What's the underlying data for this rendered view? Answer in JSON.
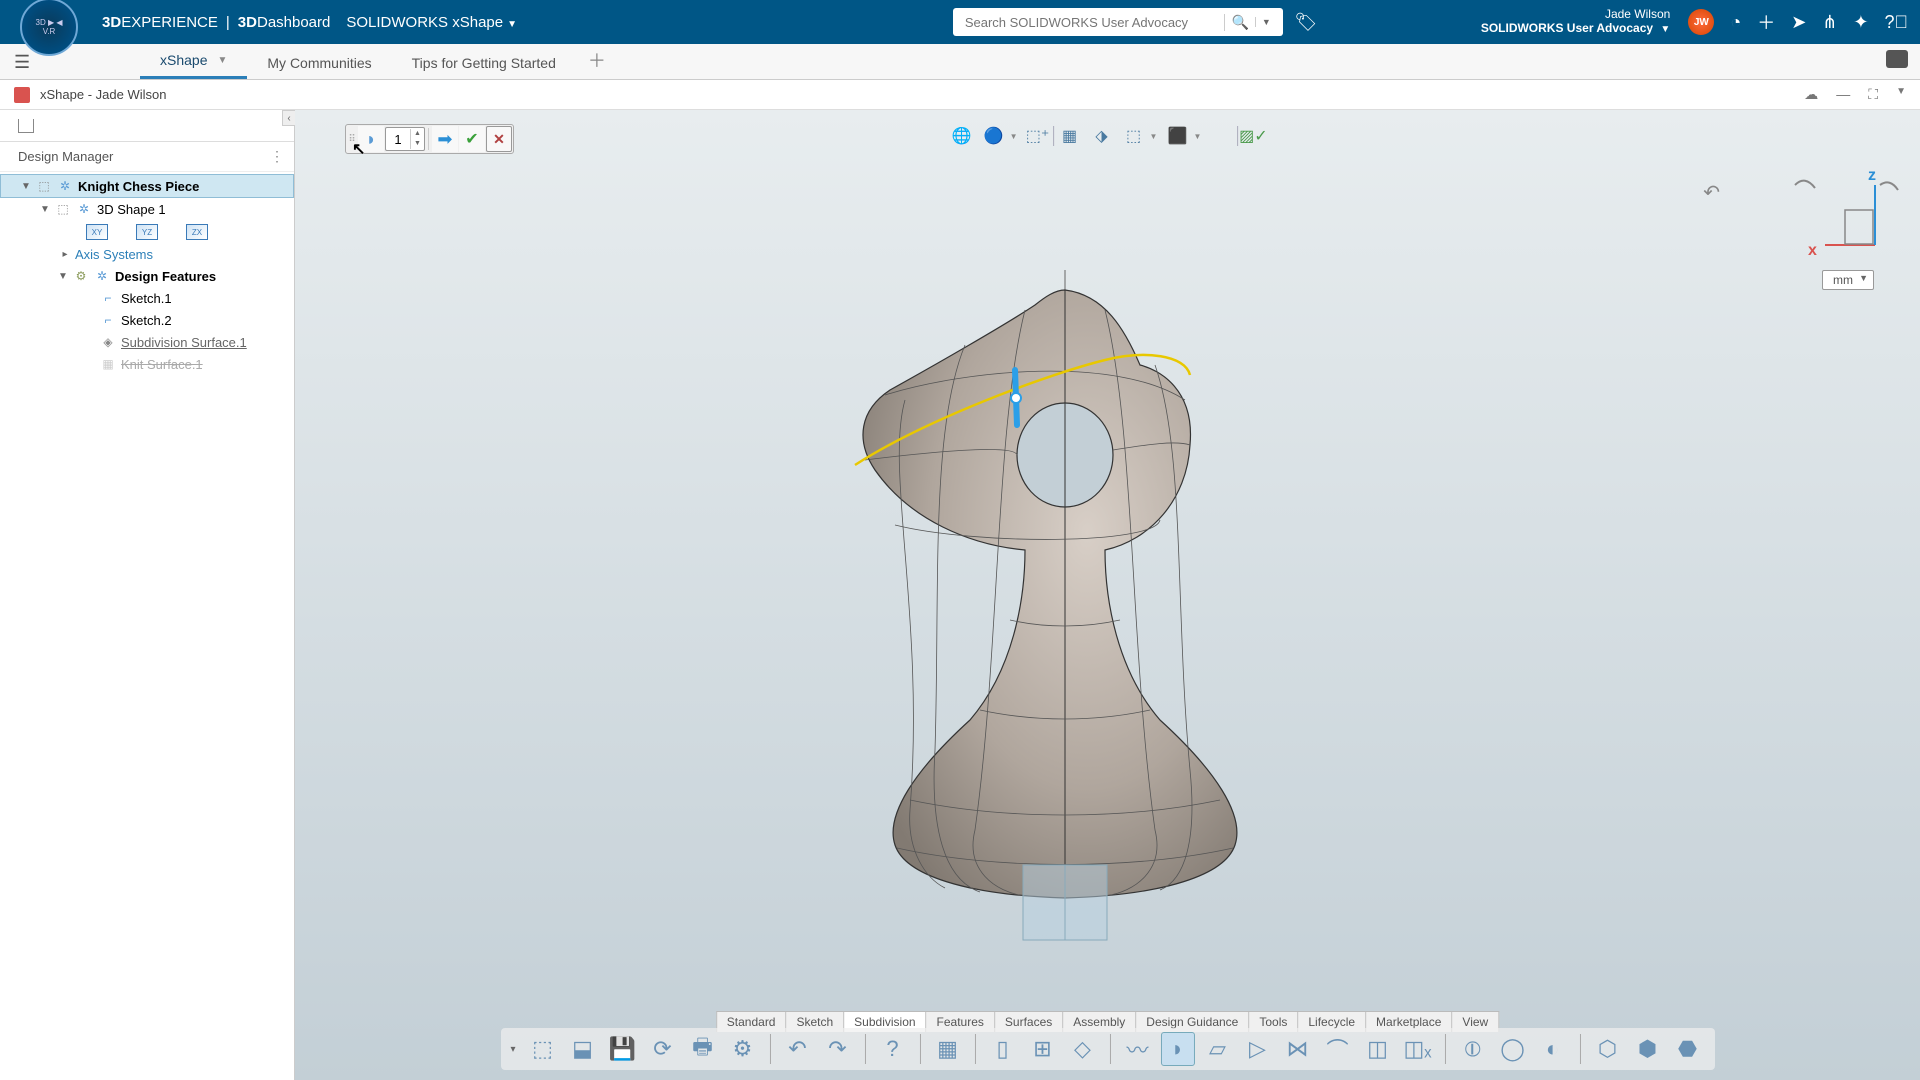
{
  "header": {
    "brand1": "3D",
    "brand2": "EXPERIENCE",
    "brand3": "3D",
    "brand4": "Dashboard",
    "app": "SOLIDWORKS xShape",
    "search_placeholder": "Search SOLIDWORKS User Advocacy",
    "user_name": "Jade Wilson",
    "user_org": "SOLIDWORKS User Advocacy",
    "avatar": "JW"
  },
  "tabs": {
    "items": [
      "xShape",
      "My Communities",
      "Tips for Getting Started"
    ]
  },
  "doc": {
    "title": "xShape - Jade Wilson"
  },
  "sidebar": {
    "header": "Design Manager",
    "tree": {
      "root": "Knight Chess Piece",
      "shape": "3D Shape 1",
      "axis": "Axis Systems",
      "features": "Design Features",
      "sketch1": "Sketch.1",
      "sketch2": "Sketch.2",
      "subdiv": "Subdivision Surface.1",
      "knit": "Knit Surface.1",
      "planes": [
        "XY",
        "YZ",
        "ZX"
      ]
    }
  },
  "float_toolbar": {
    "value": "1"
  },
  "triad": {
    "x": "x",
    "z": "z"
  },
  "units": "mm",
  "bottom_tabs": [
    "Standard",
    "Sketch",
    "Subdivision",
    "Features",
    "Surfaces",
    "Assembly",
    "Design Guidance",
    "Tools",
    "Lifecycle",
    "Marketplace",
    "View"
  ],
  "bottom_tabs_active": 2
}
